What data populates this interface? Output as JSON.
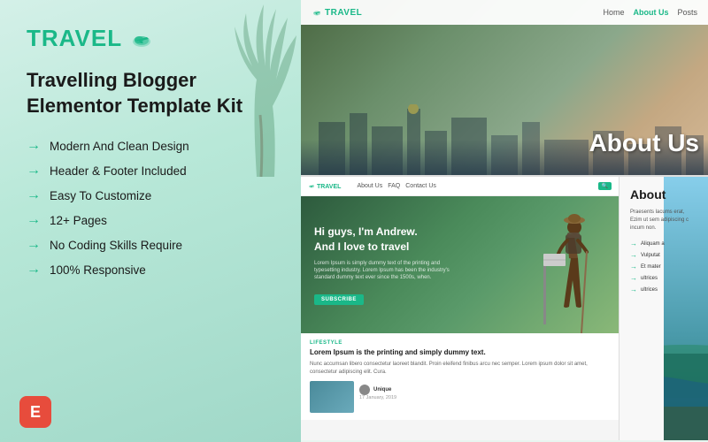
{
  "left": {
    "logo": "TRAVEL",
    "logo_icon": "plane-cloud-icon",
    "title_line1": "Travelling Blogger",
    "title_line2": "Elementor Template Kit",
    "features": [
      {
        "text": "Modern And Clean Design"
      },
      {
        "text": "Header & Footer Included"
      },
      {
        "text": "Easy To Customize"
      },
      {
        "text": "12+ Pages"
      },
      {
        "text": "No Coding Skills Require"
      },
      {
        "text": "100% Responsive"
      }
    ],
    "badge_label": "E",
    "arrow": "→"
  },
  "right": {
    "top_preview": {
      "nav": {
        "logo": "TRAVEL",
        "links": [
          "Home",
          "About Us",
          "Posts"
        ]
      },
      "hero_title": "About Us"
    },
    "bottom_left": {
      "nav": {
        "logo": "TRAVEL",
        "links": [
          "About Us",
          "FAQ",
          "Contact Us"
        ],
        "search_placeholder": "Search"
      },
      "hero": {
        "heading_line1": "Hi guys, I'm Andrew.",
        "heading_line2": "And I love to travel",
        "subtext": "Lorem Ipsum is simply dummy text of the printing and typesetting industry. Lorem Ipsum has been the industry's standard dummy text ever since the 1500s, when.",
        "cta_button": "SUBSCRIBE"
      },
      "blog": {
        "category": "LIFESTYLE",
        "title": "Lorem Ipsum is the printing and simply dummy text.",
        "description": "Nunc accumsan libero consectetur laoreet blandit. Proin eleifend finibus arcu nec semper. Lorem ipsum dolor sit amet, consectetur adipiscing elit. Cura.",
        "author": "Unique",
        "date": "17 January, 2019"
      }
    },
    "bottom_right": {
      "title": "About",
      "text": "Praesents lacums erat, Ezim ut sem adipiscing c incum non.",
      "list_items": [
        "Aliquam a",
        "Vulputat",
        "Et mater",
        "ultrices",
        "ultrices"
      ]
    }
  }
}
